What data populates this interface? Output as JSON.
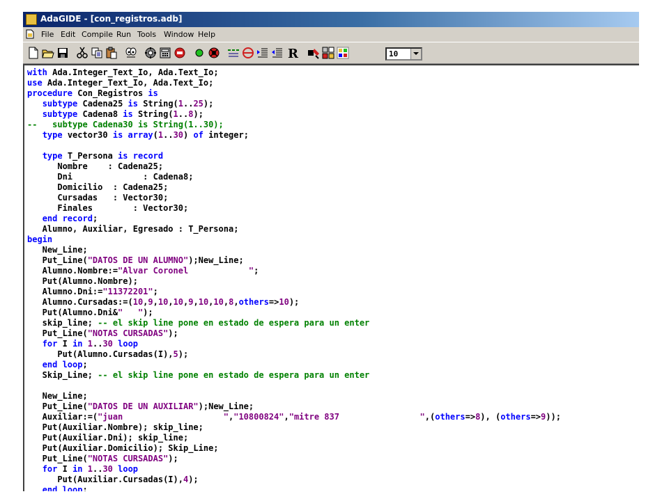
{
  "window": {
    "title": "AdaGIDE - [con_registros.adb]",
    "icon_label": "Ada 95"
  },
  "menu": [
    "File",
    "Edit",
    "Compile",
    "Run",
    "Tools",
    "Window",
    "Help"
  ],
  "toolbar": {
    "buttons": [
      "new-file-icon",
      "open-folder-icon",
      "save-icon",
      "cut-icon",
      "copy-icon",
      "paste-icon",
      "spell-icon",
      "gear-icon",
      "calculator-icon",
      "stop-icon",
      "run-icon",
      "debug-icon",
      "comment-icon",
      "uncomment-icon",
      "indent-icon",
      "outdent-icon",
      "reformat-icon",
      "tools-icon",
      "cards-icon",
      "bookmark-icon"
    ],
    "reformat_label": "R",
    "font_size": "10"
  },
  "editor": {
    "lines": [
      [
        [
          "kw",
          "with"
        ],
        [
          "t",
          " Ada.Integer_Text_Io, Ada.Text_Io;"
        ]
      ],
      [
        [
          "kw",
          "use"
        ],
        [
          "t",
          " Ada.Integer_Text_Io, Ada.Text_Io;"
        ]
      ],
      [
        [
          "kw",
          "procedure"
        ],
        [
          "t",
          " Con_Registros "
        ],
        [
          "kw",
          "is"
        ]
      ],
      [
        [
          "t",
          "   "
        ],
        [
          "kw",
          "subtype"
        ],
        [
          "t",
          " Cadena25 "
        ],
        [
          "kw",
          "is"
        ],
        [
          "t",
          " String("
        ],
        [
          "num",
          "1"
        ],
        [
          "t",
          ".."
        ],
        [
          "num",
          "25"
        ],
        [
          "t",
          ");"
        ]
      ],
      [
        [
          "t",
          "   "
        ],
        [
          "kw",
          "subtype"
        ],
        [
          "t",
          " Cadena8 "
        ],
        [
          "kw",
          "is"
        ],
        [
          "t",
          " String("
        ],
        [
          "num",
          "1"
        ],
        [
          "t",
          ".."
        ],
        [
          "num",
          "8"
        ],
        [
          "t",
          ");"
        ]
      ],
      [
        [
          "cm",
          "--   subtype Cadena30 is String(1..30);"
        ]
      ],
      [
        [
          "t",
          "   "
        ],
        [
          "kw",
          "type"
        ],
        [
          "t",
          " vector30 "
        ],
        [
          "kw",
          "is"
        ],
        [
          "t",
          " "
        ],
        [
          "kw",
          "array"
        ],
        [
          "t",
          "("
        ],
        [
          "num",
          "1"
        ],
        [
          "t",
          ".."
        ],
        [
          "num",
          "30"
        ],
        [
          "t",
          ") "
        ],
        [
          "kw",
          "of"
        ],
        [
          "t",
          " integer;"
        ]
      ],
      [
        [
          "t",
          ""
        ]
      ],
      [
        [
          "t",
          "   "
        ],
        [
          "kw",
          "type"
        ],
        [
          "t",
          " T_Persona "
        ],
        [
          "kw",
          "is"
        ],
        [
          "t",
          " "
        ],
        [
          "kw",
          "record"
        ]
      ],
      [
        [
          "t",
          "      Nombre    : Cadena25;"
        ]
      ],
      [
        [
          "t",
          "      Dni              : Cadena8;"
        ]
      ],
      [
        [
          "t",
          "      Domicilio  : Cadena25;"
        ]
      ],
      [
        [
          "t",
          "      Cursadas   : Vector30;"
        ]
      ],
      [
        [
          "t",
          "      Finales        : Vector30;"
        ]
      ],
      [
        [
          "t",
          "   "
        ],
        [
          "kw",
          "end record"
        ],
        [
          "t",
          ";"
        ]
      ],
      [
        [
          "t",
          "   Alumno, Auxiliar, Egresado : T_Persona;"
        ]
      ],
      [
        [
          "kw",
          "begin"
        ]
      ],
      [
        [
          "t",
          "   New_Line;"
        ]
      ],
      [
        [
          "t",
          "   Put_Line("
        ],
        [
          "str",
          "\"DATOS DE UN ALUMNO\""
        ],
        [
          "t",
          ");New_Line;"
        ]
      ],
      [
        [
          "t",
          "   Alumno.Nombre:="
        ],
        [
          "str",
          "\"Alvar Coronel            \""
        ],
        [
          "t",
          ";"
        ]
      ],
      [
        [
          "t",
          "   Put(Alumno.Nombre);"
        ]
      ],
      [
        [
          "t",
          "   Alumno.Dni:="
        ],
        [
          "str",
          "\"11372201\""
        ],
        [
          "t",
          ";"
        ]
      ],
      [
        [
          "t",
          "   Alumno.Cursadas:=("
        ],
        [
          "num",
          "10"
        ],
        [
          "t",
          ","
        ],
        [
          "num",
          "9"
        ],
        [
          "t",
          ","
        ],
        [
          "num",
          "10"
        ],
        [
          "t",
          ","
        ],
        [
          "num",
          "10"
        ],
        [
          "t",
          ","
        ],
        [
          "num",
          "9"
        ],
        [
          "t",
          ","
        ],
        [
          "num",
          "10"
        ],
        [
          "t",
          ","
        ],
        [
          "num",
          "10"
        ],
        [
          "t",
          ","
        ],
        [
          "num",
          "8"
        ],
        [
          "t",
          ","
        ],
        [
          "kw",
          "others"
        ],
        [
          "t",
          "=>"
        ],
        [
          "num",
          "10"
        ],
        [
          "t",
          ");"
        ]
      ],
      [
        [
          "t",
          "   Put(Alumno.Dni&"
        ],
        [
          "str",
          "\"   \""
        ],
        [
          "t",
          ");"
        ]
      ],
      [
        [
          "t",
          "   skip_line; "
        ],
        [
          "cm",
          "-- el skip line pone en estado de espera para un enter"
        ]
      ],
      [
        [
          "t",
          "   Put_Line("
        ],
        [
          "str",
          "\"NOTAS CURSADAS\""
        ],
        [
          "t",
          ");"
        ]
      ],
      [
        [
          "t",
          "   "
        ],
        [
          "kw",
          "for"
        ],
        [
          "t",
          " I "
        ],
        [
          "kw",
          "in"
        ],
        [
          "t",
          " "
        ],
        [
          "num",
          "1"
        ],
        [
          "t",
          ".."
        ],
        [
          "num",
          "30"
        ],
        [
          "t",
          " "
        ],
        [
          "kw",
          "loop"
        ]
      ],
      [
        [
          "t",
          "      Put(Alumno.Cursadas(I),"
        ],
        [
          "num",
          "5"
        ],
        [
          "t",
          ");"
        ]
      ],
      [
        [
          "t",
          "   "
        ],
        [
          "kw",
          "end loop"
        ],
        [
          "t",
          ";"
        ]
      ],
      [
        [
          "t",
          "   Skip_Line; "
        ],
        [
          "cm",
          "-- el skip line pone en estado de espera para un enter"
        ]
      ],
      [
        [
          "t",
          ""
        ]
      ],
      [
        [
          "t",
          "   New_Line;"
        ]
      ],
      [
        [
          "t",
          "   Put_Line("
        ],
        [
          "str",
          "\"DATOS DE UN AUXILIAR\""
        ],
        [
          "t",
          ");New_Line;"
        ]
      ],
      [
        [
          "t",
          "   Auxiliar:=("
        ],
        [
          "str",
          "\"juan                    \""
        ],
        [
          "t",
          ","
        ],
        [
          "str",
          "\"10800824\""
        ],
        [
          "t",
          ","
        ],
        [
          "str",
          "\"mitre 837                \""
        ],
        [
          "t",
          ",("
        ],
        [
          "kw",
          "others"
        ],
        [
          "t",
          "=>"
        ],
        [
          "num",
          "8"
        ],
        [
          "t",
          "), ("
        ],
        [
          "kw",
          "others"
        ],
        [
          "t",
          "=>"
        ],
        [
          "num",
          "9"
        ],
        [
          "t",
          "));"
        ]
      ],
      [
        [
          "t",
          "   Put(Auxiliar.Nombre); skip_line;"
        ]
      ],
      [
        [
          "t",
          "   Put(Auxiliar.Dni); skip_line;"
        ]
      ],
      [
        [
          "t",
          "   Put(Auxiliar.Domicilio); Skip_Line;"
        ]
      ],
      [
        [
          "t",
          "   Put_Line("
        ],
        [
          "str",
          "\"NOTAS CURSADAS\""
        ],
        [
          "t",
          ");"
        ]
      ],
      [
        [
          "t",
          "   "
        ],
        [
          "kw",
          "for"
        ],
        [
          "t",
          " I "
        ],
        [
          "kw",
          "in"
        ],
        [
          "t",
          " "
        ],
        [
          "num",
          "1"
        ],
        [
          "t",
          ".."
        ],
        [
          "num",
          "30"
        ],
        [
          "t",
          " "
        ],
        [
          "kw",
          "loop"
        ]
      ],
      [
        [
          "t",
          "      Put(Auxiliar.Cursadas(I),"
        ],
        [
          "num",
          "4"
        ],
        [
          "t",
          ");"
        ]
      ],
      [
        [
          "t",
          "   "
        ],
        [
          "kw",
          "end loop"
        ],
        [
          "t",
          ";"
        ]
      ]
    ]
  }
}
